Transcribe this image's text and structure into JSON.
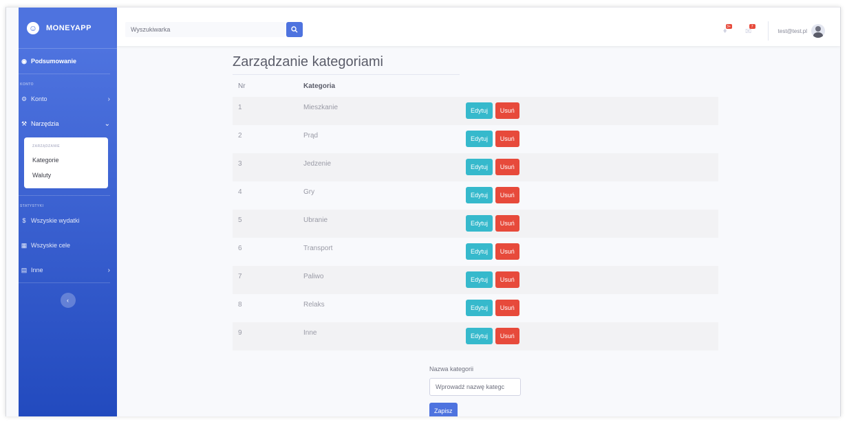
{
  "brand": {
    "name": "MONEYAPP"
  },
  "sidebar": {
    "summary": "Podsumowanie",
    "heading_account": "KONTO",
    "account": "Konto",
    "tools": "Narzędzia",
    "submenu": {
      "heading": "ZARZĄDZANIE",
      "items": [
        "Kategorie",
        "Waluty"
      ]
    },
    "heading_stats": "STATYSTYKI",
    "all_expenses": "Wszyskie wydatki",
    "all_goals": "Wszyskie cele",
    "other": "Inne"
  },
  "topbar": {
    "search_placeholder": "Wyszukiwarka",
    "user_email": "test@test.pl",
    "alerts_badge": "3+",
    "messages_badge": "7"
  },
  "page": {
    "title": "Zarządzanie kategoriami",
    "columns": {
      "nr": "Nr",
      "category": "Kategoria"
    },
    "rows": [
      {
        "nr": "1",
        "name": "Mieszkanie"
      },
      {
        "nr": "2",
        "name": "Prąd"
      },
      {
        "nr": "3",
        "name": "Jedzenie"
      },
      {
        "nr": "4",
        "name": "Gry"
      },
      {
        "nr": "5",
        "name": "Ubranie"
      },
      {
        "nr": "6",
        "name": "Transport"
      },
      {
        "nr": "7",
        "name": "Paliwo"
      },
      {
        "nr": "8",
        "name": "Relaks"
      },
      {
        "nr": "9",
        "name": "Inne"
      }
    ],
    "edit_label": "Edytuj",
    "delete_label": "Usuń"
  },
  "form": {
    "label": "Nazwa kategorii",
    "placeholder": "Wprowadź nazwę kategc",
    "save_label": "Zapisz"
  },
  "colors": {
    "primary": "#4e73df",
    "info": "#36b9cc",
    "danger": "#e74a3b"
  }
}
